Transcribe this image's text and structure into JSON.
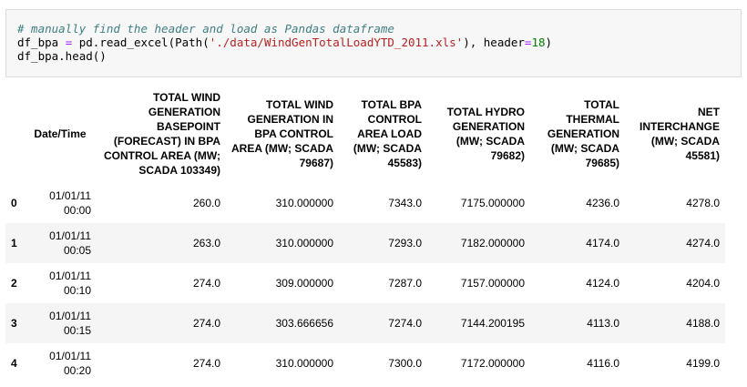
{
  "code": {
    "comment": "# manually find the header and load as Pandas dataframe",
    "line2": {
      "var": "df_bpa ",
      "eq": "=",
      "call": " pd.read_excel(Path(",
      "path": "'./data/WindGenTotalLoadYTD_2011.xls'",
      "mid": "), header",
      "eq2": "=",
      "num": "18",
      "end": ")"
    },
    "line3": "df_bpa.head()"
  },
  "table": {
    "index_header": "",
    "headers": [
      "Date/Time",
      "TOTAL WIND GENERATION BASEPOINT (FORECAST) IN BPA CONTROL AREA (MW; SCADA 103349)",
      "TOTAL WIND GENERATION IN BPA CONTROL AREA (MW; SCADA 79687)",
      "TOTAL BPA CONTROL AREA LOAD (MW; SCADA 45583)",
      "TOTAL HYDRO GENERATION (MW; SCADA 79682)",
      "TOTAL THERMAL GENERATION (MW; SCADA 79685)",
      "NET INTERCHANGE (MW; SCADA 45581)"
    ],
    "rows": [
      {
        "index": "0",
        "date": "01/01/11",
        "time": "00:00",
        "values": [
          "260.0",
          "310.000000",
          "7343.0",
          "7175.000000",
          "4236.0",
          "4278.0"
        ]
      },
      {
        "index": "1",
        "date": "01/01/11",
        "time": "00:05",
        "values": [
          "263.0",
          "310.000000",
          "7293.0",
          "7182.000000",
          "4174.0",
          "4274.0"
        ]
      },
      {
        "index": "2",
        "date": "01/01/11",
        "time": "00:10",
        "values": [
          "274.0",
          "309.000000",
          "7287.0",
          "7157.000000",
          "4124.0",
          "4204.0"
        ]
      },
      {
        "index": "3",
        "date": "01/01/11",
        "time": "00:15",
        "values": [
          "274.0",
          "303.666656",
          "7274.0",
          "7144.200195",
          "4113.0",
          "4188.0"
        ]
      },
      {
        "index": "4",
        "date": "01/01/11",
        "time": "00:20",
        "values": [
          "274.0",
          "310.000000",
          "7300.0",
          "7172.000000",
          "4116.0",
          "4199.0"
        ]
      }
    ]
  }
}
